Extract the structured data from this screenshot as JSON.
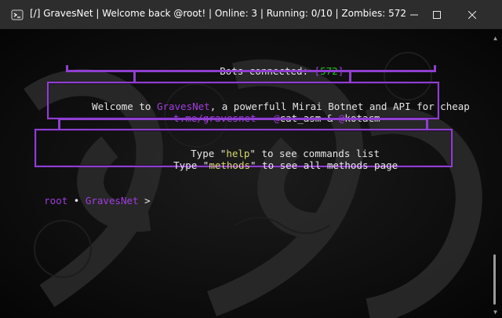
{
  "window": {
    "title": "[/] GravesNet | Welcome back @root! | Online: 3 | Running: 0/10 | Zombies: 572"
  },
  "terminal": {
    "bots_label": "Bots connected: ",
    "bots_open": "[",
    "bots_count": "572",
    "bots_close": "]",
    "welcome_prefix": "Welcome to ",
    "welcome_brand": "GravesNet",
    "welcome_suffix": ", a powerfull Mirai Botnet and API for cheap",
    "link_url": "t.me/gravesnet",
    "link_sep": " - ",
    "link_at1": "@",
    "link_user1": "cat_asm",
    "link_amp": " & ",
    "link_at2": "@",
    "link_user2": "kotacm",
    "help_prefix": "Type \"",
    "help_cmd": "help",
    "help_suffix": "\" to see commands list",
    "methods_prefix": "Type \"",
    "methods_cmd": "methods",
    "methods_suffix": "\" to see all methods page",
    "prompt_user": "root",
    "prompt_bullet": " • ",
    "prompt_host": "GravesNet",
    "prompt_arrow": " >"
  },
  "colors": {
    "accent_purple": "#a23dde",
    "box_purple": "#8f3fd0",
    "count_green": "#19c919",
    "cmd_yellow": "#d8d86c",
    "titlebar": "#2d2d2d"
  },
  "icons": [
    "terminal-icon",
    "minimize-icon",
    "maximize-icon",
    "close-icon"
  ]
}
